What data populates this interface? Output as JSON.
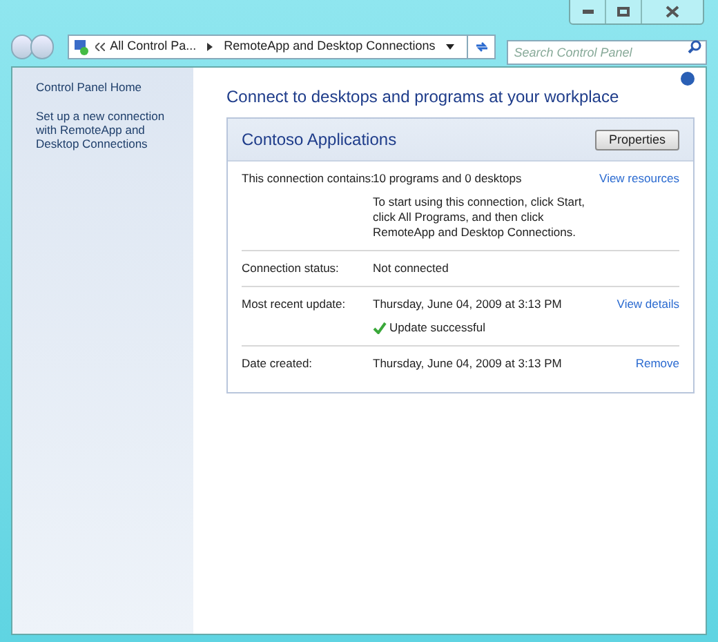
{
  "address_bar": {
    "breadcrumbs": [
      "All Control Pa...",
      "RemoteApp and Desktop Connections"
    ]
  },
  "search": {
    "placeholder": "Search Control Panel"
  },
  "sidebar": {
    "links": [
      "Control Panel Home",
      "Set up a new connection with RemoteApp and Desktop Connections"
    ]
  },
  "main": {
    "heading": "Connect to desktops and programs at your workplace",
    "card": {
      "title": "Contoso Applications",
      "button": "Properties",
      "rows": [
        {
          "label": "This connection contains:",
          "value": "10 programs and 0 desktops",
          "note": "To start using this connection, click Start, click All Programs, and then click RemoteApp and Desktop Connections.",
          "link": "View resources"
        },
        {
          "label": "Connection status:",
          "value": "Not connected"
        },
        {
          "label": "Most recent update:",
          "value": "Thursday, June 04, 2009 at 3:13 PM",
          "status": "Update successful",
          "link": "View details"
        },
        {
          "label": "Date created:",
          "value": "Thursday, June 04, 2009 at 3:13 PM",
          "link": "Remove"
        }
      ]
    }
  }
}
